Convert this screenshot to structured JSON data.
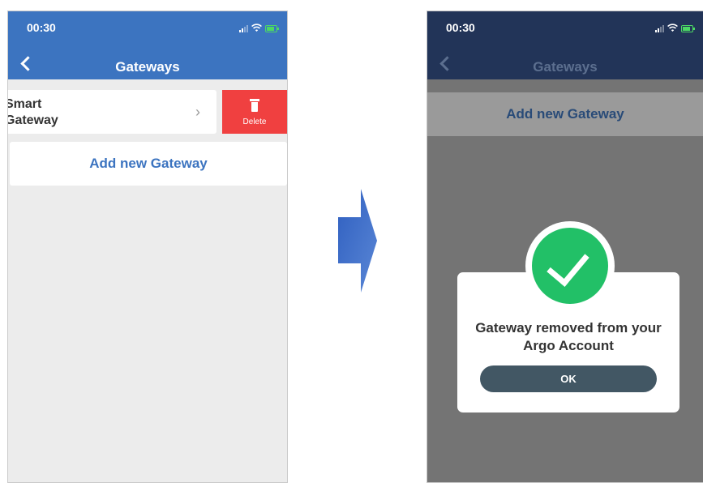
{
  "left": {
    "status": {
      "time": "00:30"
    },
    "header": {
      "title": "Gateways"
    },
    "gateway": {
      "name_line1": "Smart",
      "name_line2": "Gateway",
      "chevron": "›"
    },
    "delete_label": "Delete",
    "add_label": "Add new Gateway"
  },
  "right": {
    "status": {
      "time": "00:30"
    },
    "header": {
      "title": "Gateways"
    },
    "add_label": "Add new Gateway",
    "dialog": {
      "message_line1": "Gateway removed from your",
      "message_line2": "Argo Account",
      "ok_label": "OK"
    }
  },
  "colors": {
    "header_blue": "#3c74c0",
    "delete_red": "#f04040",
    "success_green": "#22c067",
    "ok_button": "#425764"
  },
  "icons": [
    "back-chevron-icon",
    "signal-icon",
    "wifi-icon",
    "battery-icon",
    "trash-icon",
    "checkmark-icon",
    "arrow-right-icon"
  ]
}
